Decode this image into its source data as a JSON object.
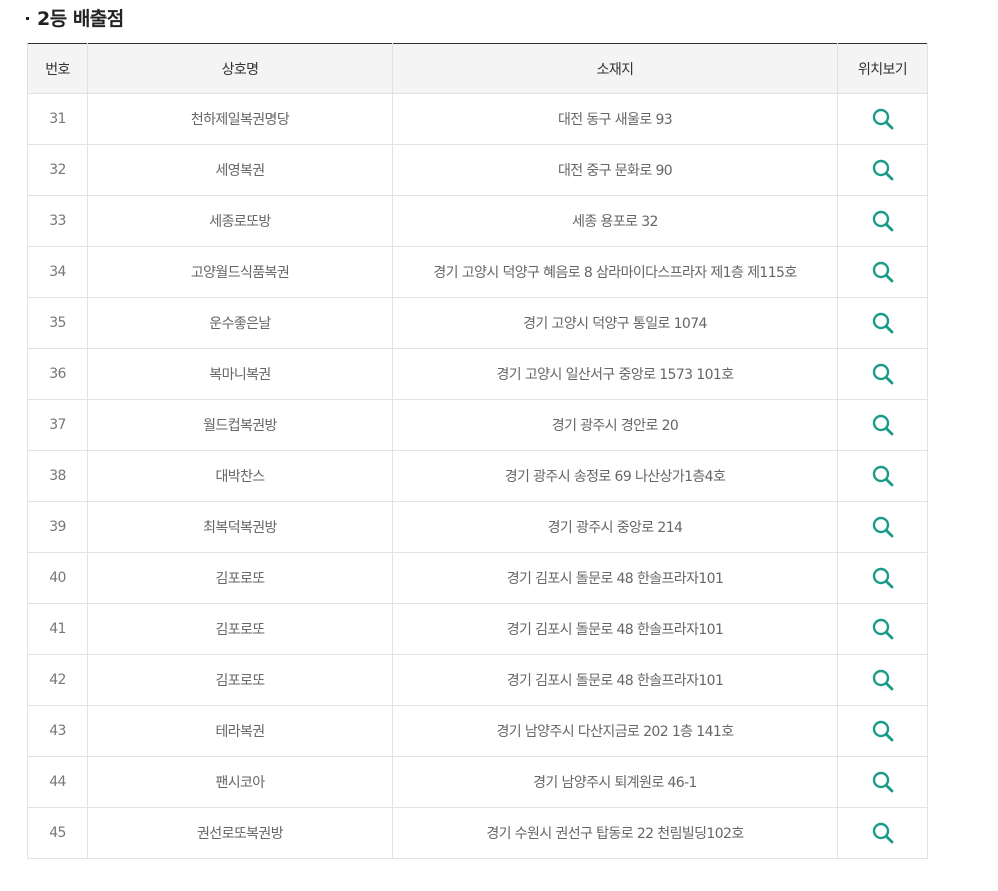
{
  "section": {
    "title": "2등 배출점"
  },
  "table": {
    "headers": {
      "number": "번호",
      "name": "상호명",
      "address": "소재지",
      "map": "위치보기"
    },
    "rows": [
      {
        "no": "31",
        "name": "천하제일복권명당",
        "address": "대전 동구 새울로 93"
      },
      {
        "no": "32",
        "name": "세영복권",
        "address": "대전 중구 문화로 90"
      },
      {
        "no": "33",
        "name": "세종로또방",
        "address": "세종 용포로 32"
      },
      {
        "no": "34",
        "name": "고양월드식품복권",
        "address": "경기 고양시 덕양구 혜음로 8 삼라마이다스프라자 제1층 제115호"
      },
      {
        "no": "35",
        "name": "운수좋은날",
        "address": "경기 고양시 덕양구 통일로 1074"
      },
      {
        "no": "36",
        "name": "복마니복권",
        "address": "경기 고양시 일산서구 중앙로 1573 101호"
      },
      {
        "no": "37",
        "name": "월드컵복권방",
        "address": "경기 광주시 경안로 20"
      },
      {
        "no": "38",
        "name": "대박찬스",
        "address": "경기 광주시 송정로 69 나산상가1층4호"
      },
      {
        "no": "39",
        "name": "최복덕복권방",
        "address": "경기 광주시 중앙로 214"
      },
      {
        "no": "40",
        "name": "김포로또",
        "address": "경기 김포시 돌문로 48 한솔프라자101"
      },
      {
        "no": "41",
        "name": "김포로또",
        "address": "경기 김포시 돌문로 48 한솔프라자101"
      },
      {
        "no": "42",
        "name": "김포로또",
        "address": "경기 김포시 돌문로 48 한솔프라자101"
      },
      {
        "no": "43",
        "name": "테라복권",
        "address": "경기 남양주시 다산지금로 202 1층 141호"
      },
      {
        "no": "44",
        "name": "팬시코아",
        "address": "경기 남양주시 퇴계원로 46-1"
      },
      {
        "no": "45",
        "name": "권선로또복권방",
        "address": "경기 수원시 권선구 탑동로 22 천림빌딩102호"
      }
    ],
    "map_icon": "search-icon"
  },
  "colors": {
    "accent": "#1a9b8a",
    "header_bg": "#f4f4f4",
    "border": "#e3e3e3",
    "top_border": "#333333"
  }
}
